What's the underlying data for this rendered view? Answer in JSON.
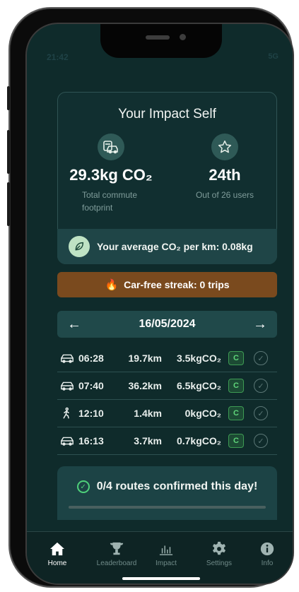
{
  "status_bar": {
    "time": "21:42",
    "signal_text": "5G"
  },
  "impact_card": {
    "title": "Your Impact Self",
    "footprint": {
      "value": "29.3kg CO₂",
      "label": "Total commute footprint"
    },
    "rank": {
      "value": "24th",
      "label": "Out of 26 users"
    },
    "average": "Your average CO₂ per km: 0.08kg"
  },
  "streak": {
    "text": "Car-free streak: 0 trips"
  },
  "date_nav": {
    "date": "16/05/2024",
    "prev": "←",
    "next": "→"
  },
  "trips": [
    {
      "mode": "car",
      "time": "06:28",
      "distance": "19.7km",
      "co2": "3.5kgCO₂",
      "badge": "C"
    },
    {
      "mode": "car",
      "time": "07:40",
      "distance": "36.2km",
      "co2": "6.5kgCO₂",
      "badge": "C"
    },
    {
      "mode": "walk",
      "time": "12:10",
      "distance": "1.4km",
      "co2": "0kgCO₂",
      "badge": "C"
    },
    {
      "mode": "car",
      "time": "16:13",
      "distance": "3.7km",
      "co2": "0.7kgCO₂",
      "badge": "C"
    }
  ],
  "confirm": {
    "text": "0/4 routes confirmed this day!",
    "progress": 0
  },
  "tabs": [
    {
      "label": "Home",
      "icon": "home-icon",
      "active": true
    },
    {
      "label": "Leaderboard",
      "icon": "trophy-icon",
      "active": false
    },
    {
      "label": "Impact",
      "icon": "bar-chart-icon",
      "active": false
    },
    {
      "label": "Settings",
      "icon": "gear-icon",
      "active": false
    },
    {
      "label": "Info",
      "icon": "info-icon",
      "active": false
    }
  ],
  "colors": {
    "background": "#0f2b2b",
    "accent_green": "#4ed07a",
    "streak_brown": "#7a4a1e"
  }
}
